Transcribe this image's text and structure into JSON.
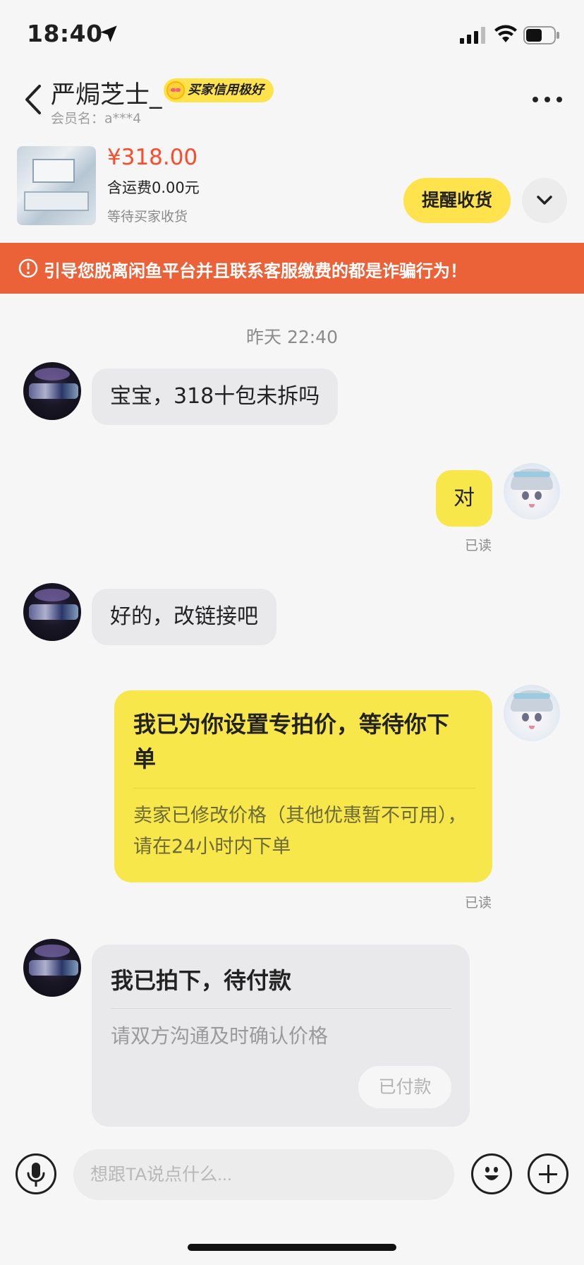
{
  "status_bar": {
    "time": "18:40"
  },
  "header": {
    "nickname": "严焗芝士_",
    "credit_badge": "买家信用极好",
    "member_label": "会员名：a***4"
  },
  "order": {
    "price": "¥318.00",
    "shipping": "含运费0.00元",
    "status": "等待买家收货",
    "remind_button": "提醒收货"
  },
  "warning": {
    "text": "引导您脱离闲鱼平台并且联系客服缴费的都是诈骗行为！"
  },
  "chat": {
    "timestamp": "昨天 22:40",
    "messages": [
      {
        "from": "buyer",
        "text": "宝宝，318十包未拆吗"
      },
      {
        "from": "me",
        "text": "对",
        "read": "已读"
      },
      {
        "from": "buyer",
        "text": "好的，改链接吧"
      }
    ],
    "price_card": {
      "title": "我已为你设置专拍价，等待你下单",
      "subtitle": "卖家已修改价格（其他优惠暂不可用），请在24小时内下单",
      "read": "已读"
    },
    "order_card": {
      "title": "我已拍下，待付款",
      "subtitle": "请双方沟通及时确认价格",
      "button": "已付款"
    }
  },
  "input_bar": {
    "placeholder": "想跟TA说点什么..."
  },
  "colors": {
    "accent_yellow": "#ffe34d",
    "price_red": "#ff4a2a",
    "warning_orange": "#ec6238"
  }
}
